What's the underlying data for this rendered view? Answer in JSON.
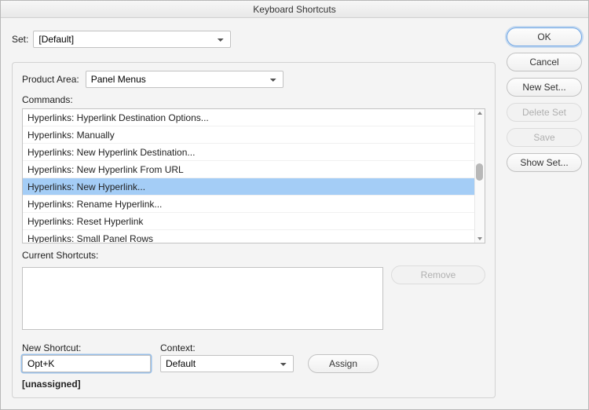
{
  "window": {
    "title": "Keyboard Shortcuts"
  },
  "set": {
    "label": "Set:",
    "value": "[Default]"
  },
  "productArea": {
    "label": "Product Area:",
    "value": "Panel Menus"
  },
  "commands": {
    "label": "Commands:",
    "items": [
      "Hyperlinks: Hyperlink Destination Options...",
      "Hyperlinks: Manually",
      "Hyperlinks: New Hyperlink Destination...",
      "Hyperlinks: New Hyperlink From URL",
      "Hyperlinks: New Hyperlink...",
      "Hyperlinks: Rename Hyperlink...",
      "Hyperlinks: Reset Hyperlink",
      "Hyperlinks: Small Panel Rows"
    ],
    "selectedIndex": 4
  },
  "currentShortcuts": {
    "label": "Current Shortcuts:",
    "removeLabel": "Remove"
  },
  "newShortcut": {
    "label": "New Shortcut:",
    "value": "Opt+K"
  },
  "context": {
    "label": "Context:",
    "value": "Default"
  },
  "assignLabel": "Assign",
  "statusText": "[unassigned]",
  "buttons": {
    "ok": "OK",
    "cancel": "Cancel",
    "newSet": "New Set...",
    "deleteSet": "Delete Set",
    "save": "Save",
    "showSet": "Show Set..."
  }
}
